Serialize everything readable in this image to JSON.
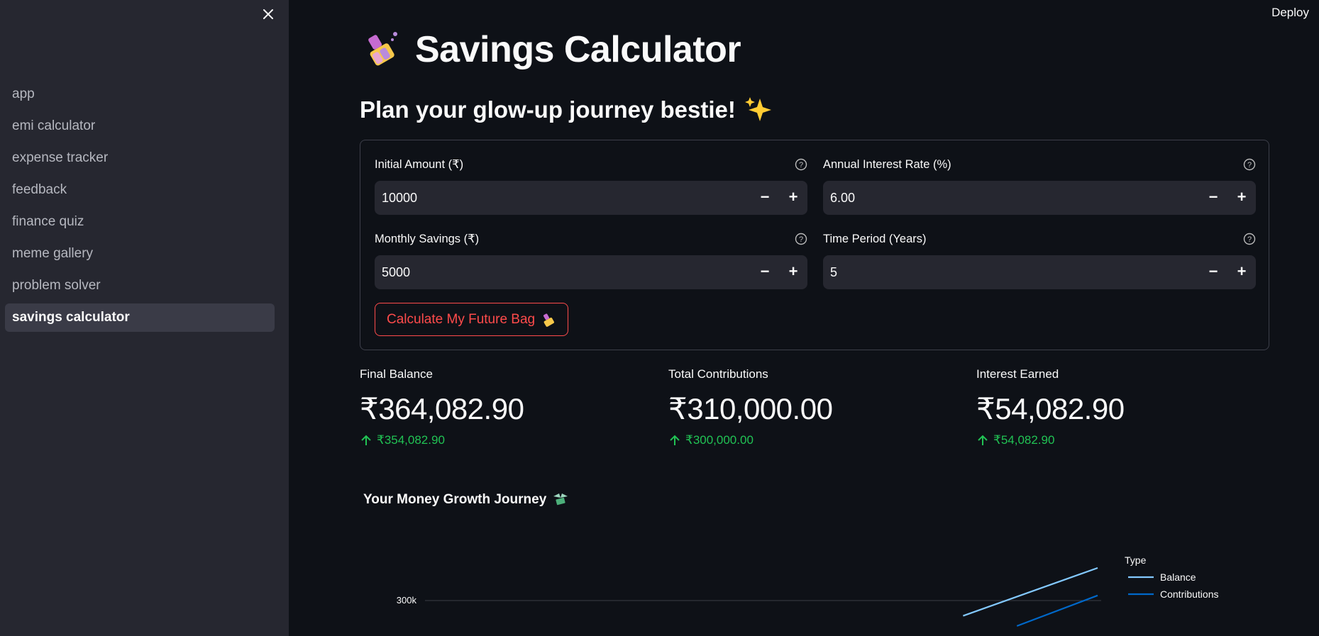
{
  "header": {
    "deploy_label": "Deploy"
  },
  "sidebar": {
    "items": [
      {
        "label": "app",
        "active": false
      },
      {
        "label": "emi calculator",
        "active": false
      },
      {
        "label": "expense tracker",
        "active": false
      },
      {
        "label": "feedback",
        "active": false
      },
      {
        "label": "finance quiz",
        "active": false
      },
      {
        "label": "meme gallery",
        "active": false
      },
      {
        "label": "problem solver",
        "active": false
      },
      {
        "label": "savings calculator",
        "active": true
      }
    ]
  },
  "main": {
    "title": "Savings Calculator",
    "title_icon": "nail-polish-emoji",
    "subtitle": "Plan your glow-up journey bestie!",
    "subtitle_icon": "sparkles-emoji",
    "form": {
      "initial_amount": {
        "label": "Initial Amount (₹)",
        "value": "10000"
      },
      "interest_rate": {
        "label": "Annual Interest Rate (%)",
        "value": "6.00"
      },
      "monthly_savings": {
        "label": "Monthly Savings (₹)",
        "value": "5000"
      },
      "time_period": {
        "label": "Time Period (Years)",
        "value": "5"
      },
      "stepper_minus": "−",
      "stepper_plus": "+",
      "submit_label": "Calculate My Future Bag"
    },
    "metrics": [
      {
        "label": "Final Balance",
        "value": "₹364,082.90",
        "delta": "₹354,082.90"
      },
      {
        "label": "Total Contributions",
        "value": "₹310,000.00",
        "delta": "₹300,000.00"
      },
      {
        "label": "Interest Earned",
        "value": "₹54,082.90",
        "delta": "₹54,082.90"
      }
    ],
    "chart_title": "Your Money Growth Journey",
    "chart_title_icon": "money-with-wings-emoji"
  },
  "colors": {
    "accent": "#ff4b4b",
    "positive": "#21c354",
    "balance_line": "#83c9ff",
    "contributions_line": "#0068c9"
  },
  "chart_data": {
    "type": "line",
    "x_label_visible": false,
    "y_ticks": [
      "300k"
    ],
    "legend_title": "Type",
    "legend_placement": "top-right",
    "series": [
      {
        "name": "Balance",
        "x": [
          4,
          5
        ],
        "y": [
          270000,
          364082.9
        ]
      },
      {
        "name": "Contributions",
        "x": [
          4.4,
          5
        ],
        "y": [
          250000,
          310000
        ]
      }
    ],
    "grid": true
  }
}
